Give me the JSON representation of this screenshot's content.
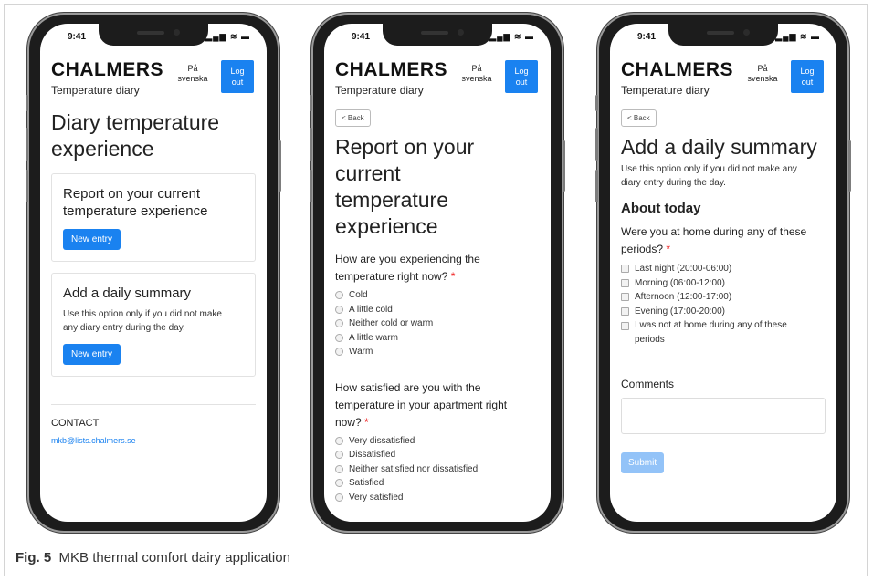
{
  "status_time": "9:41",
  "status_icons": "▂▄▆ ≋ ▬",
  "brand": "CHALMERS",
  "subtitle": "Temperature diary",
  "lang_line1": "På",
  "lang_line2": "svenska",
  "logout_line1": "Log",
  "logout_line2": "out",
  "back": "< Back",
  "screen1": {
    "title_line1": "Diary temperature",
    "title_line2": "experience",
    "card1": {
      "title_line1": "Report on your current",
      "title_line2": "temperature experience",
      "button": "New entry"
    },
    "card2": {
      "title": "Add a daily summary",
      "text_line1": "Use this option only if you did not make",
      "text_line2": "any diary entry during the day.",
      "button": "New entry"
    },
    "contact_heading": "CONTACT",
    "contact_email": "mkb@lists.chalmers.se"
  },
  "screen2": {
    "title_line1": "Report on your current",
    "title_line2": "temperature",
    "title_line3": "experience",
    "q1_line1": "How are you experiencing the",
    "q1_line2": "temperature right now?",
    "q1_options": [
      "Cold",
      "A little cold",
      "Neither cold or warm",
      "A little warm",
      "Warm"
    ],
    "q2_line1": "How satisfied are you with the",
    "q2_line2": "temperature in your apartment right",
    "q2_line3": "now?",
    "q2_options": [
      "Very dissatisfied",
      "Dissatisfied",
      "Neither satisfied nor dissatisfied",
      "Satisfied",
      "Very satisfied"
    ]
  },
  "screen3": {
    "title": "Add a daily summary",
    "intro_line1": "Use this option only if you did not make any",
    "intro_line2": "diary entry during the day.",
    "about": "About today",
    "q_line1": "Were you at home during any of these",
    "q_line2": "periods?",
    "options": [
      "Last night (20:00-06:00)",
      "Morning (06:00-12:00)",
      "Afternoon (12:00-17:00)",
      "Evening (17:00-20:00)"
    ],
    "option_last_line1": "I was not at home during any of these",
    "option_last_line2": "periods",
    "comments": "Comments",
    "submit": "Submit"
  },
  "required_mark": "*",
  "caption_label": "Fig. 5",
  "caption_text": "MKB thermal comfort dairy application"
}
